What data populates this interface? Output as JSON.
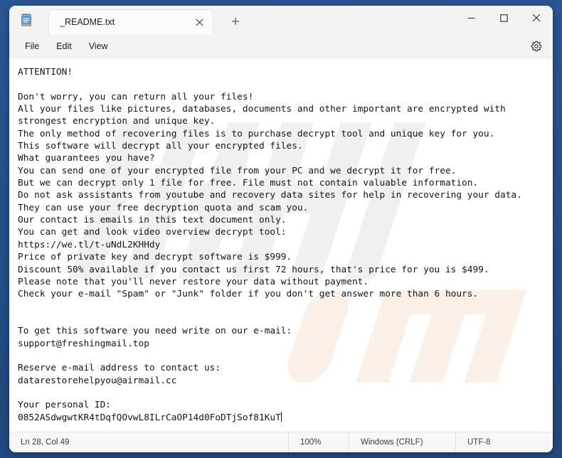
{
  "window": {
    "app_icon": "notepad-icon",
    "minimize_label": "Minimize",
    "maximize_label": "Maximize",
    "close_label": "Close"
  },
  "tabs": [
    {
      "title": "_README.txt",
      "close_label": "Close tab",
      "active": true
    }
  ],
  "new_tab": {
    "label": "+",
    "tooltip": "New tab"
  },
  "menubar": {
    "items": [
      {
        "label": "File"
      },
      {
        "label": "Edit"
      },
      {
        "label": "View"
      }
    ],
    "settings_icon": "gear-icon"
  },
  "editor": {
    "content": "ATTENTION!\n\nDon't worry, you can return all your files!\nAll your files like pictures, databases, documents and other important are encrypted with\nstrongest encryption and unique key.\nThe only method of recovering files is to purchase decrypt tool and unique key for you.\nThis software will decrypt all your encrypted files.\nWhat guarantees you have?\nYou can send one of your encrypted file from your PC and we decrypt it for free.\nBut we can decrypt only 1 file for free. File must not contain valuable information.\nDo not ask assistants from youtube and recovery data sites for help in recovering your data.\nThey can use your free decryption quota and scam you.\nOur contact is emails in this text document only.\nYou can get and look video overview decrypt tool:\nhttps://we.tl/t-uNdL2KHHdy\nPrice of private key and decrypt software is $999.\nDiscount 50% available if you contact us first 72 hours, that's price for you is $499.\nPlease note that you'll never restore your data without payment.\nCheck your e-mail \"Spam\" or \"Junk\" folder if you don't get answer more than 6 hours.\n\n\nTo get this software you need write on our e-mail:\nsupport@freshingmail.top\n\nReserve e-mail address to contact us:\ndatarestorehelpyou@airmail.cc\n\nYour personal ID:\n0852ASdwgwtKR4tDqfQOvwL8ILrCaOP14d0FoDTjSof81KuT"
  },
  "statusbar": {
    "position": "Ln 28, Col 49",
    "zoom": "100%",
    "line_endings": "Windows (CRLF)",
    "encoding": "UTF-8"
  },
  "colors": {
    "desktop": "#2b5797",
    "window": "#f3f3f3",
    "editor_bg": "#ffffff",
    "text": "#141414"
  }
}
